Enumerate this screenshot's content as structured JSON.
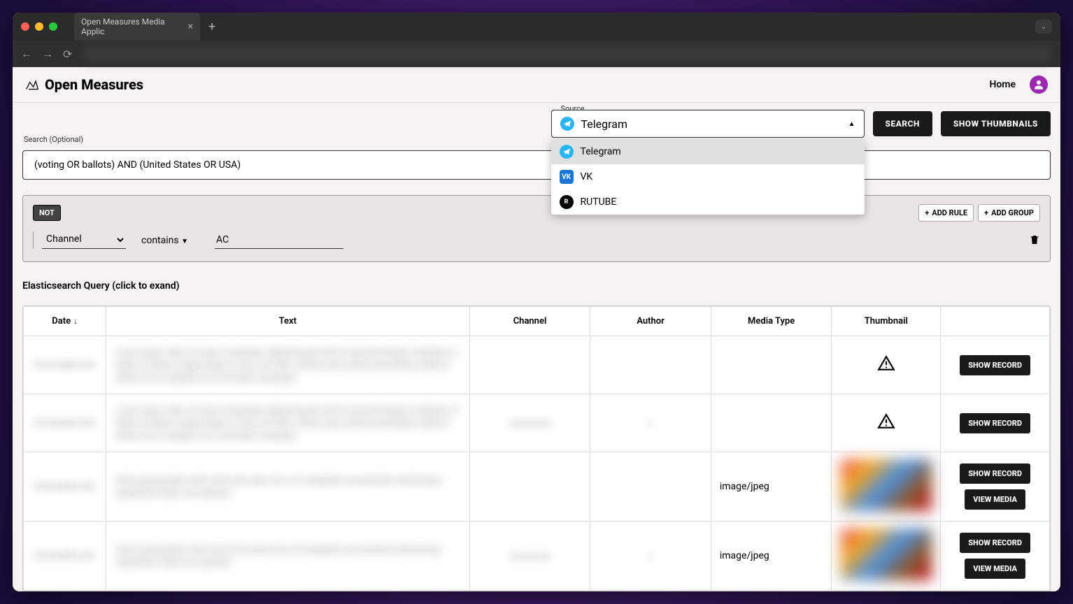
{
  "browser": {
    "tab_title": "Open Measures Media Applic"
  },
  "header": {
    "app_title": "Open Measures",
    "home_label": "Home"
  },
  "source": {
    "legend": "Source",
    "selected": "Telegram",
    "options": [
      {
        "label": "Telegram",
        "icon": "telegram"
      },
      {
        "label": "VK",
        "icon": "vk"
      },
      {
        "label": "RUTUBE",
        "icon": "rutube"
      }
    ]
  },
  "buttons": {
    "search": "SEARCH",
    "show_thumbnails": "SHOW THUMBNAILS",
    "add_rule": "ADD RULE",
    "add_group": "ADD GROUP",
    "show_record": "SHOW RECORD",
    "view_media": "VIEW MEDIA"
  },
  "search": {
    "legend": "Search (Optional)",
    "value": "(voting OR ballots) AND (United States OR USA)"
  },
  "query_builder": {
    "not_label": "NOT",
    "rule": {
      "field": "Channel",
      "operator": "contains",
      "value": "AC"
    }
  },
  "es_query": {
    "label": "Elasticsearch Query (click to exand)"
  },
  "table": {
    "headers": {
      "date": "Date",
      "text": "Text",
      "channel": "Channel",
      "author": "Author",
      "media_type": "Media Type",
      "thumbnail": "Thumbnail"
    },
    "rows": [
      {
        "date": "",
        "text": "",
        "channel": "",
        "author": "",
        "media_type": "",
        "thumbnail": "warn",
        "actions": [
          "show_record"
        ]
      },
      {
        "date": "",
        "text": "",
        "channel": "",
        "author": "",
        "media_type": "",
        "thumbnail": "warn",
        "actions": [
          "show_record"
        ]
      },
      {
        "date": "",
        "text": "",
        "channel": "",
        "author": "",
        "media_type": "image/jpeg",
        "thumbnail": "image",
        "actions": [
          "show_record",
          "view_media"
        ]
      },
      {
        "date": "",
        "text": "",
        "channel": "",
        "author": "",
        "media_type": "image/jpeg",
        "thumbnail": "image",
        "actions": [
          "show_record",
          "view_media"
        ]
      }
    ]
  }
}
